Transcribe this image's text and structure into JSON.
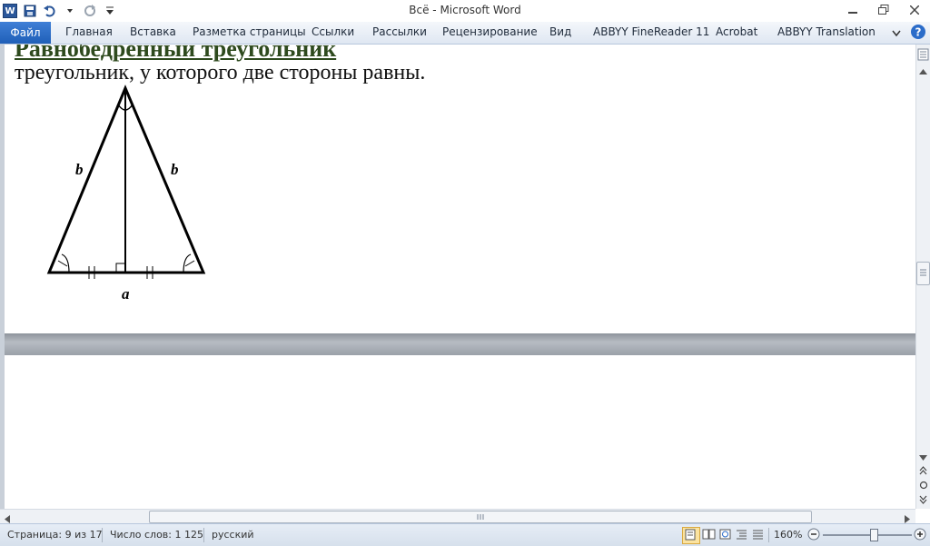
{
  "window": {
    "title": "Всё  -  Microsoft Word",
    "app_icon_letter": "W"
  },
  "ribbon": {
    "file_tab": "Файл",
    "tabs": [
      "Главная",
      "Вставка",
      "Разметка страницы",
      "Ссылки",
      "Рассылки",
      "Рецензирование",
      "Вид",
      "ABBYY FineReader 11",
      "Acrobat",
      "ABBYY Translation"
    ]
  },
  "document": {
    "heading_partial": "Равнобедренный треугольник",
    "line1": "треугольник, у которого две стороны равны.",
    "figure": {
      "left_side_label": "b",
      "right_side_label": "b",
      "base_label": "a"
    }
  },
  "status": {
    "page": "Страница: 9 из 17",
    "words": "Число слов: 1 125",
    "language": "русский",
    "zoom": "160%"
  },
  "colors": {
    "file_tab": "#2b6cc9",
    "heading": "#2e4a1e",
    "accent": "#2b579a"
  }
}
